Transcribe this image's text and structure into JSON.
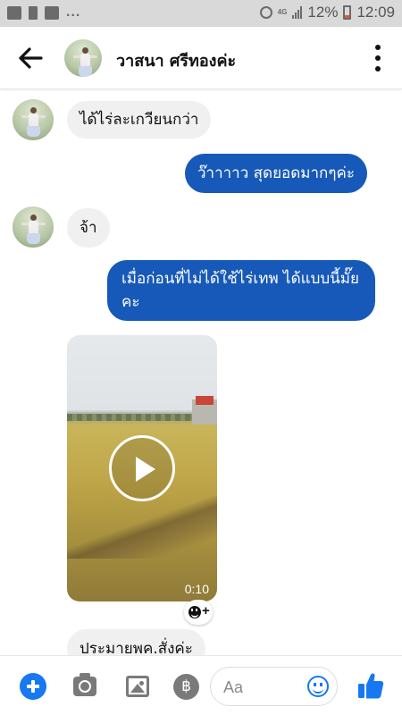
{
  "status_bar": {
    "left_icons": [
      "image-icon",
      "warning-icon",
      "facebook-icon"
    ],
    "overflow_dots": "...",
    "network": "4G",
    "battery_percent": "12%",
    "time": "12:09",
    "battery_level": 0.12
  },
  "header": {
    "back_icon": "arrow-left-icon",
    "contact_name": "วาสนา ศรีทองค่ะ",
    "more_icon": "more-vertical-icon"
  },
  "messages": [
    {
      "direction": "incoming",
      "text": "ได้ไร่ละเกวียนกว่า"
    },
    {
      "direction": "outgoing",
      "text": "ว๊าาาาว สุดยอดมากๆค่ะ"
    },
    {
      "direction": "incoming",
      "text": "จ้า"
    },
    {
      "direction": "outgoing",
      "text": "เมื่อก่อนที่ไม่ได้ใช้ไร่เทพ ได้แบบนี้มั๊ยคะ"
    },
    {
      "direction": "incoming",
      "type": "video",
      "duration": "0:10"
    },
    {
      "direction": "incoming",
      "text": "ประมายพค.สั่งค่ะ"
    }
  ],
  "composer": {
    "placeholder": "Aa",
    "pay_symbol": "฿",
    "icons": [
      "plus-icon",
      "camera-icon",
      "image-icon",
      "baht-icon",
      "emoji-icon",
      "thumbs-up-icon"
    ]
  },
  "colors": {
    "outgoing_bubble": "#1759b8",
    "incoming_bubble": "#f0f0f0",
    "accent": "#1877f2",
    "status_bar_bg": "#d9d9d9"
  }
}
